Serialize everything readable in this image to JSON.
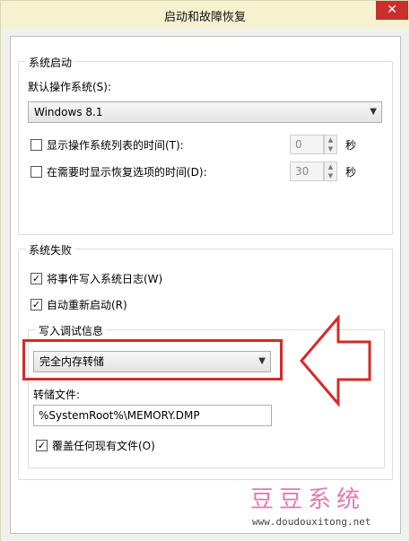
{
  "window": {
    "title": "启动和故障恢复",
    "close": "✕"
  },
  "startup": {
    "group_title": "系统启动",
    "default_os_label": "默认操作系统(S):",
    "default_os_value": "Windows 8.1",
    "show_os_list_label": "显示操作系统列表的时间(T):",
    "show_os_list_value": "0",
    "show_recovery_label": "在需要时显示恢复选项的时间(D):",
    "show_recovery_value": "30",
    "seconds": "秒"
  },
  "failure": {
    "group_title": "系统失败",
    "write_event_log": "将事件写入系统日志(W)",
    "auto_restart": "自动重新启动(R)",
    "debug_group_title": "写入调试信息",
    "debug_type_value": "完全内存转储",
    "dump_file_label": "转储文件:",
    "dump_file_value": "%SystemRoot%\\MEMORY.DMP",
    "overwrite": "覆盖任何现有文件(O)"
  },
  "watermark": {
    "brand": "豆豆系统",
    "url": "www.doudouxitong.net"
  },
  "colors": {
    "highlight_red": "#d42a2a",
    "titlebar": "#f6f1cf",
    "close": "#c9302c"
  }
}
